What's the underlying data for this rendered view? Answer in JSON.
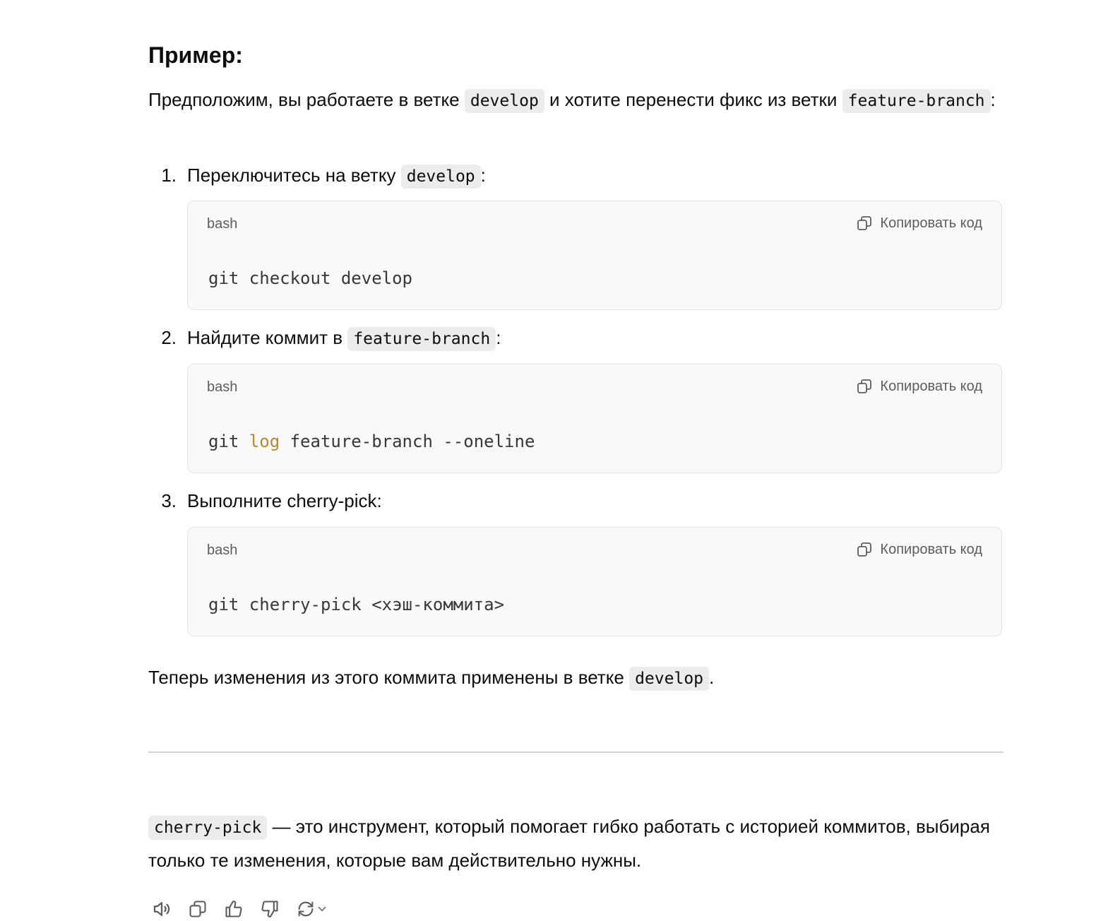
{
  "heading": "Пример:",
  "intro": {
    "text_before": "Предположим, вы работаете в ветке ",
    "code1": "develop",
    "text_mid": " и хотите перенести фикс из ветки ",
    "code2": "feature-branch",
    "text_after": ":"
  },
  "steps": [
    {
      "number": "1.",
      "text": "Переключитесь на ветку ",
      "code": "develop",
      "suffix": ":",
      "block": {
        "lang": "bash",
        "copy_label": "Копировать код",
        "code_a": "git checkout develop",
        "code_kw": "",
        "code_b": ""
      }
    },
    {
      "number": "2.",
      "text": "Найдите коммит в ",
      "code": "feature-branch",
      "suffix": ":",
      "block": {
        "lang": "bash",
        "copy_label": "Копировать код",
        "code_a": "git ",
        "code_kw": "log",
        "code_b": " feature-branch --oneline"
      }
    },
    {
      "number": "3.",
      "text": "Выполните cherry-pick:",
      "code": "",
      "suffix": "",
      "block": {
        "lang": "bash",
        "copy_label": "Копировать код",
        "code_a": "git cherry-pick <хэш-коммита>",
        "code_kw": "",
        "code_b": ""
      }
    }
  ],
  "final": {
    "text": "Теперь изменения из этого коммита применены в ветке ",
    "code": "develop",
    "suffix": "."
  },
  "summary": {
    "code": "cherry-pick",
    "text": " — это инструмент, который помогает гибко работать с историей коммитов, выбирая только те изменения, которые вам действительно нужны."
  },
  "actions": [
    "speaker-icon",
    "copy-icon",
    "thumbs-up-icon",
    "thumbs-down-icon",
    "regenerate-icon"
  ],
  "colors": {
    "inline_code_bg": "#ececec",
    "code_block_bg": "#f9f9f9",
    "keyword": "#b8882e",
    "muted_text": "#5d5d5d"
  }
}
